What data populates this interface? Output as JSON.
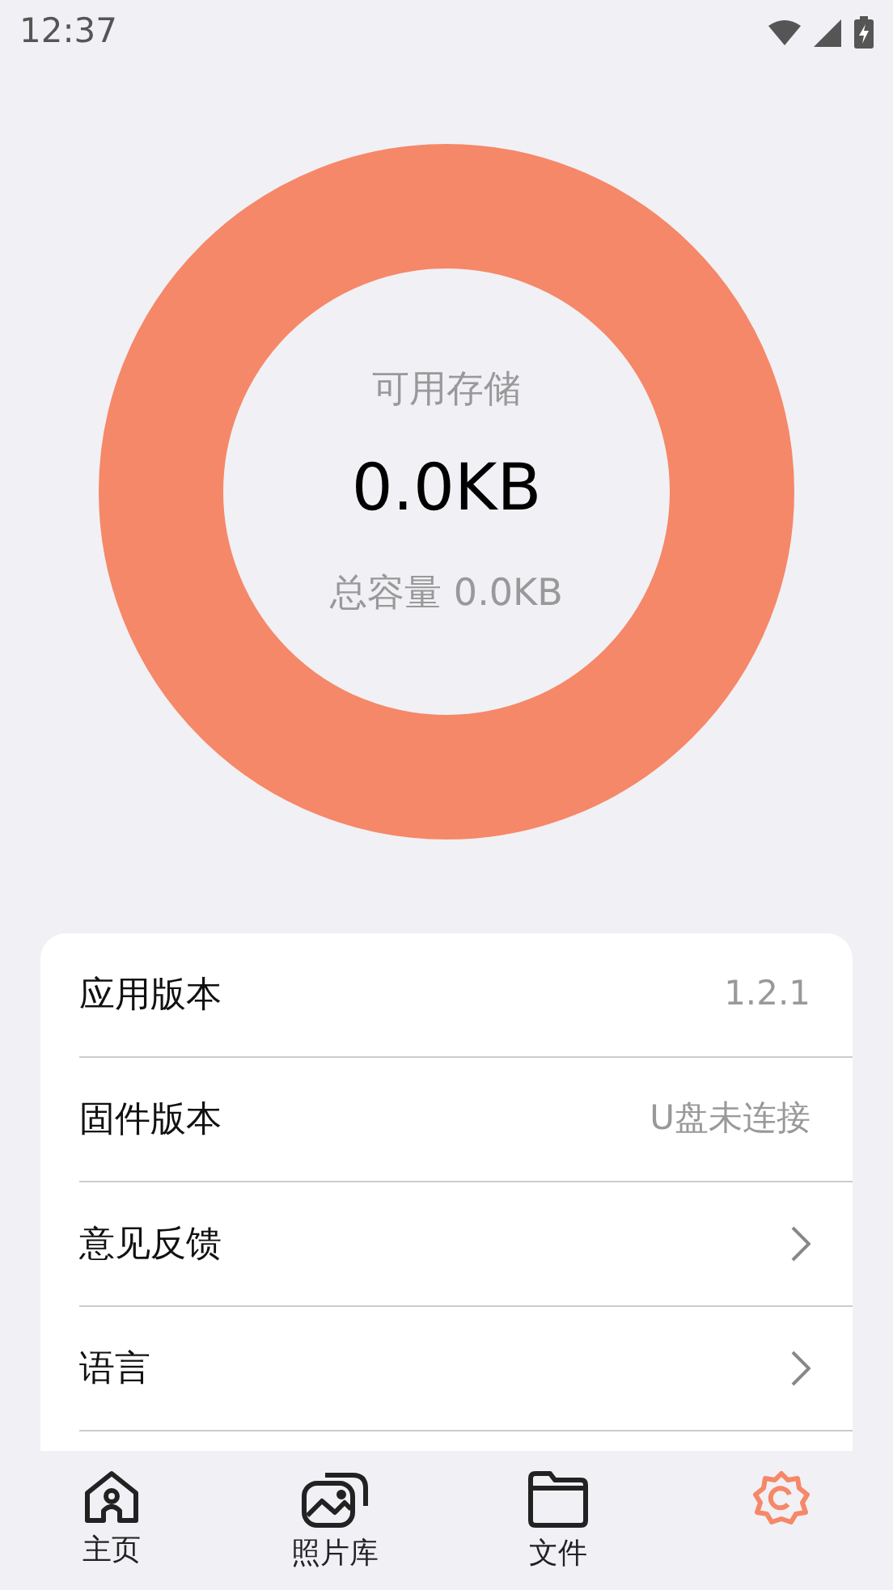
{
  "status_bar": {
    "time": "12:37"
  },
  "storage": {
    "label": "可用存储",
    "available": "0.0KB",
    "total": "总容量 0.0KB"
  },
  "settings": [
    {
      "kind": "value",
      "label": "应用版本",
      "value": "1.2.1"
    },
    {
      "kind": "value",
      "label": "固件版本",
      "value": "U盘未连接"
    },
    {
      "kind": "link",
      "label": "意见反馈"
    },
    {
      "kind": "link",
      "label": "语言"
    }
  ],
  "tabs": [
    {
      "kind": "home",
      "label": "主页",
      "selected": false
    },
    {
      "kind": "photos",
      "label": "照片库",
      "selected": false
    },
    {
      "kind": "folder",
      "label": "文件",
      "selected": false
    },
    {
      "kind": "gear",
      "selected": true
    }
  ]
}
